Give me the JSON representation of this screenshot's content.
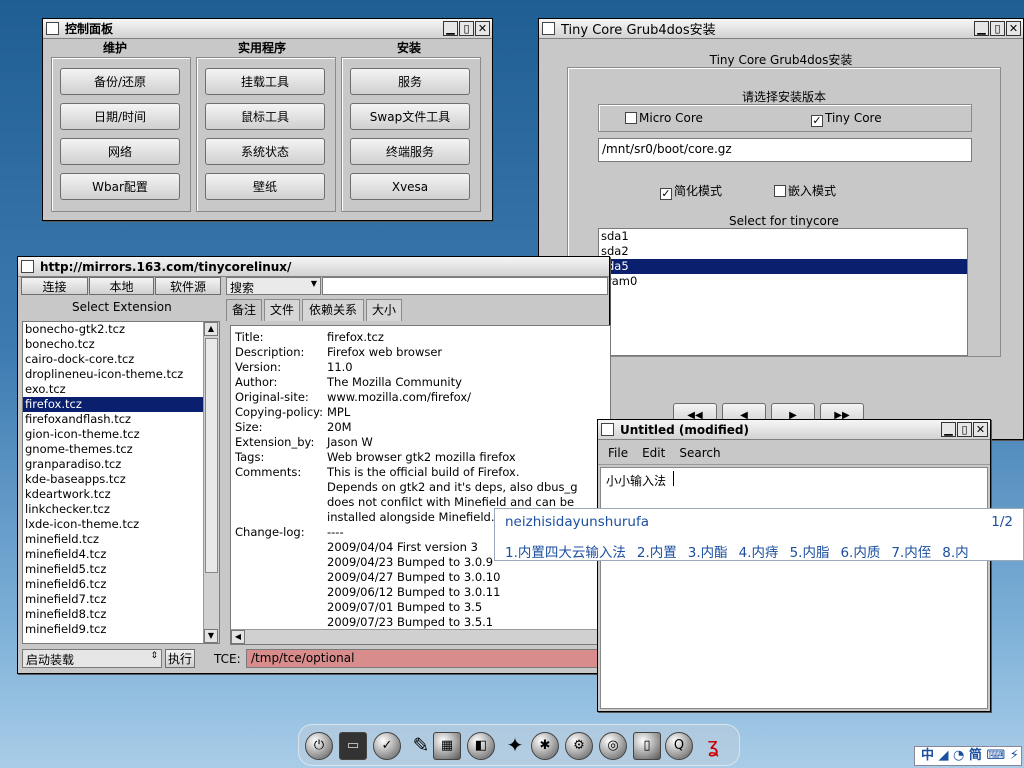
{
  "control_panel": {
    "title": "控制面板",
    "groups": [
      {
        "title": "维护",
        "buttons": [
          "备份/还原",
          "日期/时间",
          "网络",
          "Wbar配置"
        ]
      },
      {
        "title": "实用程序",
        "buttons": [
          "挂载工具",
          "鼠标工具",
          "系统状态",
          "壁纸"
        ]
      },
      {
        "title": "安装",
        "buttons": [
          "服务",
          "Swap文件工具",
          "终端服务",
          "Xvesa"
        ]
      }
    ]
  },
  "grub": {
    "title": "Tiny Core Grub4dos安装",
    "heading": "Tiny Core Grub4dos安装",
    "select_version": "请选择安装版本",
    "opt_micro": "Micro Core",
    "opt_tiny": "Tiny Core",
    "path": "/mnt/sr0/boot/core.gz",
    "opt_simple": "简化模式",
    "opt_embed": "嵌入模式",
    "select_for": "Select  for tinycore",
    "partitions": [
      "sda1",
      "sda2",
      "sda5",
      "zram0"
    ],
    "selected_partition": "sda5",
    "nav": [
      "◀◀",
      "◀",
      "▶",
      "▶▶"
    ]
  },
  "apps": {
    "title": "http://mirrors.163.com/tinycorelinux/",
    "btn_connect": "连接",
    "btn_local": "本地",
    "btn_source": "软件源",
    "search_mode": "搜索",
    "search_value": "",
    "select_ext_label": "Select Extension",
    "extensions": [
      "bonecho-gtk2.tcz",
      "bonecho.tcz",
      "cairo-dock-core.tcz",
      "droplineneu-icon-theme.tcz",
      "exo.tcz",
      "firefox.tcz",
      "firefoxandflash.tcz",
      "gion-icon-theme.tcz",
      "gnome-themes.tcz",
      "granparadiso.tcz",
      "kde-baseapps.tcz",
      "kdeartwork.tcz",
      "linkchecker.tcz",
      "lxde-icon-theme.tcz",
      "minefield.tcz",
      "minefield4.tcz",
      "minefield5.tcz",
      "minefield6.tcz",
      "minefield7.tcz",
      "minefield8.tcz",
      "minefield9.tcz"
    ],
    "selected_extension": "firefox.tcz",
    "tabs": [
      "备注",
      "文件",
      "依赖关系",
      "大小"
    ],
    "info": [
      [
        "Title:",
        "firefox.tcz"
      ],
      [
        "Description:",
        "Firefox web browser"
      ],
      [
        "Version:",
        "11.0"
      ],
      [
        "Author:",
        "The Mozilla Community"
      ],
      [
        "Original-site:",
        "www.mozilla.com/firefox/"
      ],
      [
        "Copying-policy:",
        "MPL"
      ],
      [
        "Size:",
        "20M"
      ],
      [
        "Extension_by:",
        "Jason W"
      ],
      [
        "Tags:",
        "Web browser gtk2 mozilla firefox"
      ],
      [
        "Comments:",
        "This is the official build of Firefox."
      ],
      [
        "",
        "Depends on gtk2 and it's deps, also dbus_g"
      ],
      [
        "",
        "does not confilct with Minefield and can be"
      ],
      [
        "",
        "installed alongside Minefield."
      ],
      [
        "Change-log:",
        "----"
      ],
      [
        "",
        "2009/04/04 First version 3"
      ],
      [
        "",
        "2009/04/23 Bumped to 3.0.9"
      ],
      [
        "",
        "2009/04/27 Bumped to 3.0.10"
      ],
      [
        "",
        "2009/06/12 Bumped to 3.0.11"
      ],
      [
        "",
        "2009/07/01 Bumped to 3.5"
      ],
      [
        "",
        "2009/07/23 Bumped to 3.5.1"
      ]
    ],
    "mode": "启动装载",
    "mode_btn": "执行",
    "tce_label": "TCE:",
    "tce_path": "/tmp/tce/optional"
  },
  "editor": {
    "title": "Untitled  (modified)",
    "menu": [
      "File",
      "Edit",
      "Search"
    ],
    "text": "小小输入法"
  },
  "ime": {
    "pinyin": "neizhisidayunshurufa",
    "page": "1/2",
    "candidates": [
      "1.内置四大云输入法",
      "2.内置",
      "3.内酯",
      "4.内痔",
      "5.内脂",
      "6.内质",
      "7.内侄",
      "8.内"
    ],
    "status": "中 ◢ ◔ 简 ⌨ ⚡"
  },
  "colors": {
    "selection": "#0a1f6e",
    "tce_field": "#d98c8c",
    "ime_text": "#1b4fa0"
  }
}
